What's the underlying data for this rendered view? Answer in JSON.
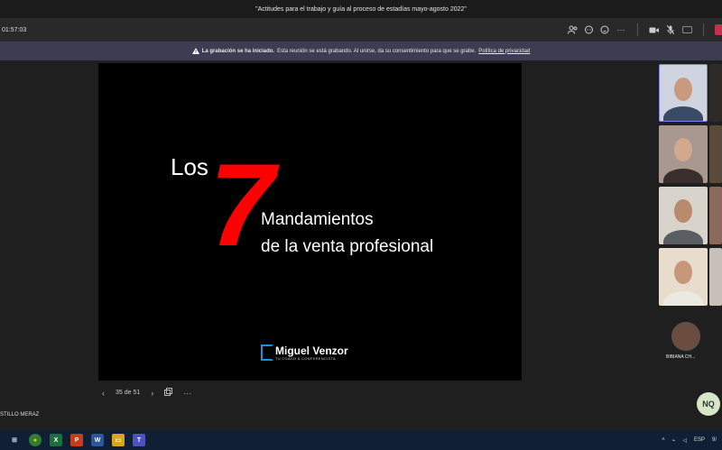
{
  "window": {
    "title": "\"Actitudes para el trabajo y guía al proceso de estadías mayo-agosto 2022\""
  },
  "toolbar": {
    "timer": "01:57:03",
    "icons": [
      "participants-icon",
      "chat-icon",
      "reactions-icon",
      "more-icon",
      "camera-icon",
      "mic-icon",
      "share-icon"
    ]
  },
  "banner": {
    "bold": "La grabación se ha iniciado.",
    "text": "Esta reunión se está grabando. Al unirse, da su consentimiento para que se grabe.",
    "link": "Política de privacidad"
  },
  "slide": {
    "los": "Los",
    "seven": "7",
    "line1": "Mandamientos",
    "line2": "de la venta profesional",
    "logo_name": "Miguel Venzor",
    "logo_sub": "TU COACH & CONFERENCISTA"
  },
  "pager": {
    "text": "35 de 51",
    "prev": "‹",
    "next": "›",
    "more": "···"
  },
  "presenter": {
    "name": "STILLO MERAZ"
  },
  "rail": {
    "avatar_name": "BIBIANA CH...",
    "initials": "NQ"
  },
  "taskbar": {
    "apps": [
      {
        "name": "task-view",
        "glyph": "⊞",
        "color": "#101f33"
      },
      {
        "name": "chrome",
        "glyph": "●",
        "color": "#2f7d32"
      },
      {
        "name": "excel",
        "glyph": "X",
        "color": "#1d6f42"
      },
      {
        "name": "powerpoint",
        "glyph": "P",
        "color": "#c43e1c"
      },
      {
        "name": "word",
        "glyph": "W",
        "color": "#2b579a"
      },
      {
        "name": "file-explorer",
        "glyph": "▭",
        "color": "#d9a520"
      },
      {
        "name": "teams",
        "glyph": "T",
        "color": "#4b53bc"
      }
    ],
    "lang": "ESP",
    "time": "9/"
  }
}
